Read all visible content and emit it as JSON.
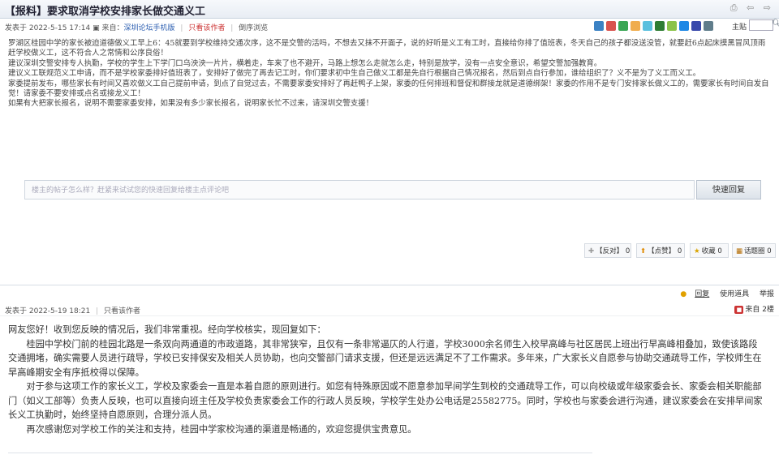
{
  "thread": {
    "title": "【报料】要求取消学校安排家长做交通义工",
    "title_actions": "⎙ ⇦ ⇨"
  },
  "post1": {
    "time": "发表于 2022-5-15 17:14",
    "from_label": "来自：",
    "from_client": "深圳论坛手机版",
    "only_author": "只看该作者",
    "reverse": "倒序浏览",
    "author_label": "主贴",
    "paragraphs": [
      "罗湖区桂园中学的家长被迫道德做义工早上6：45就要到学校维持交通次序，这不是交警的活吗，不想去又抹不开面子，说的好听是义工有工时，直接给你排了值班表，冬天自己的孩子都没送没管，就要赶6点起床摸黑冒风顶雨赶学校做义工，这不符合人之常情和公序良俗！",
      "建议深圳交警安排专人执勤，学校的学生上下学门口乌泱泱一片片，横着走，车来了也不避开，马路上想怎么走就怎么走，特别是放学，没有一点安全意识，希望交警加强教育。",
      "建议义工联规范义工申请，而不是学校家委排好值班表了，安排好了做完了再去记工时，你们要求初中生自己做义工都是先自行根据自己情况报名，然后到点自行参加，谁给组织了？义不是为了义工而义工。",
      "家委提前发布，哪些家长有时间又喜欢做义工自己提前申请，到点了自觉过去，不需要家委安排好了再赶鸭子上架，家委的任何排班和督促和群接龙就是道德绑架！家委的作用不是专门安排家长做义工的，需要家长有时间自发自觉！请家委不要安排或点名或接龙义工！",
      "如果有大把家长报名，说明不需要家委安排，如果没有多少家长报名，说明家长忙不过来，请深圳交警支援！"
    ]
  },
  "quick_reply": {
    "placeholder": "楼主的帖子怎么样？赶紧来试试您的快速回复给楼主点评论吧",
    "button": "快速回复"
  },
  "post_actions": {
    "oppose": "【反对】",
    "oppose_count": "0",
    "support": "【点赞】",
    "support_count": "0",
    "favorite": "收藏",
    "favorite_count": "0",
    "topic_circle": "话题圈",
    "topic_count": "0"
  },
  "floor_tools": {
    "reply": "回复",
    "use_tool": "使用道具",
    "report": "举报"
  },
  "post2": {
    "time": "发表于 2022-5-19 18:21",
    "only_author": "只看该作者",
    "from_label": "来自",
    "floor": "2楼",
    "paragraphs": [
      "网友您好！收到您反映的情况后，我们非常重视。经向学校核实，现回复如下：",
      "　　桂园中学校门前的桂园北路是一条双向两通道的市政道路，其非常狭窄，且仅有一条非常逼仄的人行道，学校3000余名师生入校早高峰与社区居民上班出行早高峰相叠加，致使该路段交通拥堵，确实需要人员进行疏导，学校已安排保安及相关人员协助，也向交警部门请求支援，但还是远远满足不了工作需求。多年来，广大家长义自愿参与协助交通疏导工作，学校师生在早高峰期安全有序抵校得以保障。",
      "　　对于参与这项工作的家长义工，学校及家委会一直是本着自愿的原则进行。如您有特殊原因或不愿意参加早间学生到校的交通疏导工作，可以向校级或年级家委会长、家委会相关职能部门（如义工部等）负责人反映，也可以直接向班主任及学校负责家委会工作的行政人员反映，学校学生处办公电话是25582775。同时，学校也与家委会进行沟通，建议家委会在安排早间家长义工执勤时，始终坚持自愿原则，合理分派人员。",
      "　　再次感谢您对学校工作的关注和支持，桂园中学家校沟通的渠道是畅通的，欢迎您提供宝贵意见。"
    ]
  },
  "icons": {
    "toolbar": [
      "plus-icon",
      "share-icon",
      "camera-icon",
      "user-icon",
      "grid-icon",
      "image-icon",
      "bookmark-icon",
      "heart-icon",
      "star-icon",
      "person-icon"
    ],
    "colors": {
      "link": "#2a5db0",
      "accent_red": "#cc3333",
      "border": "#c9d3df"
    }
  }
}
